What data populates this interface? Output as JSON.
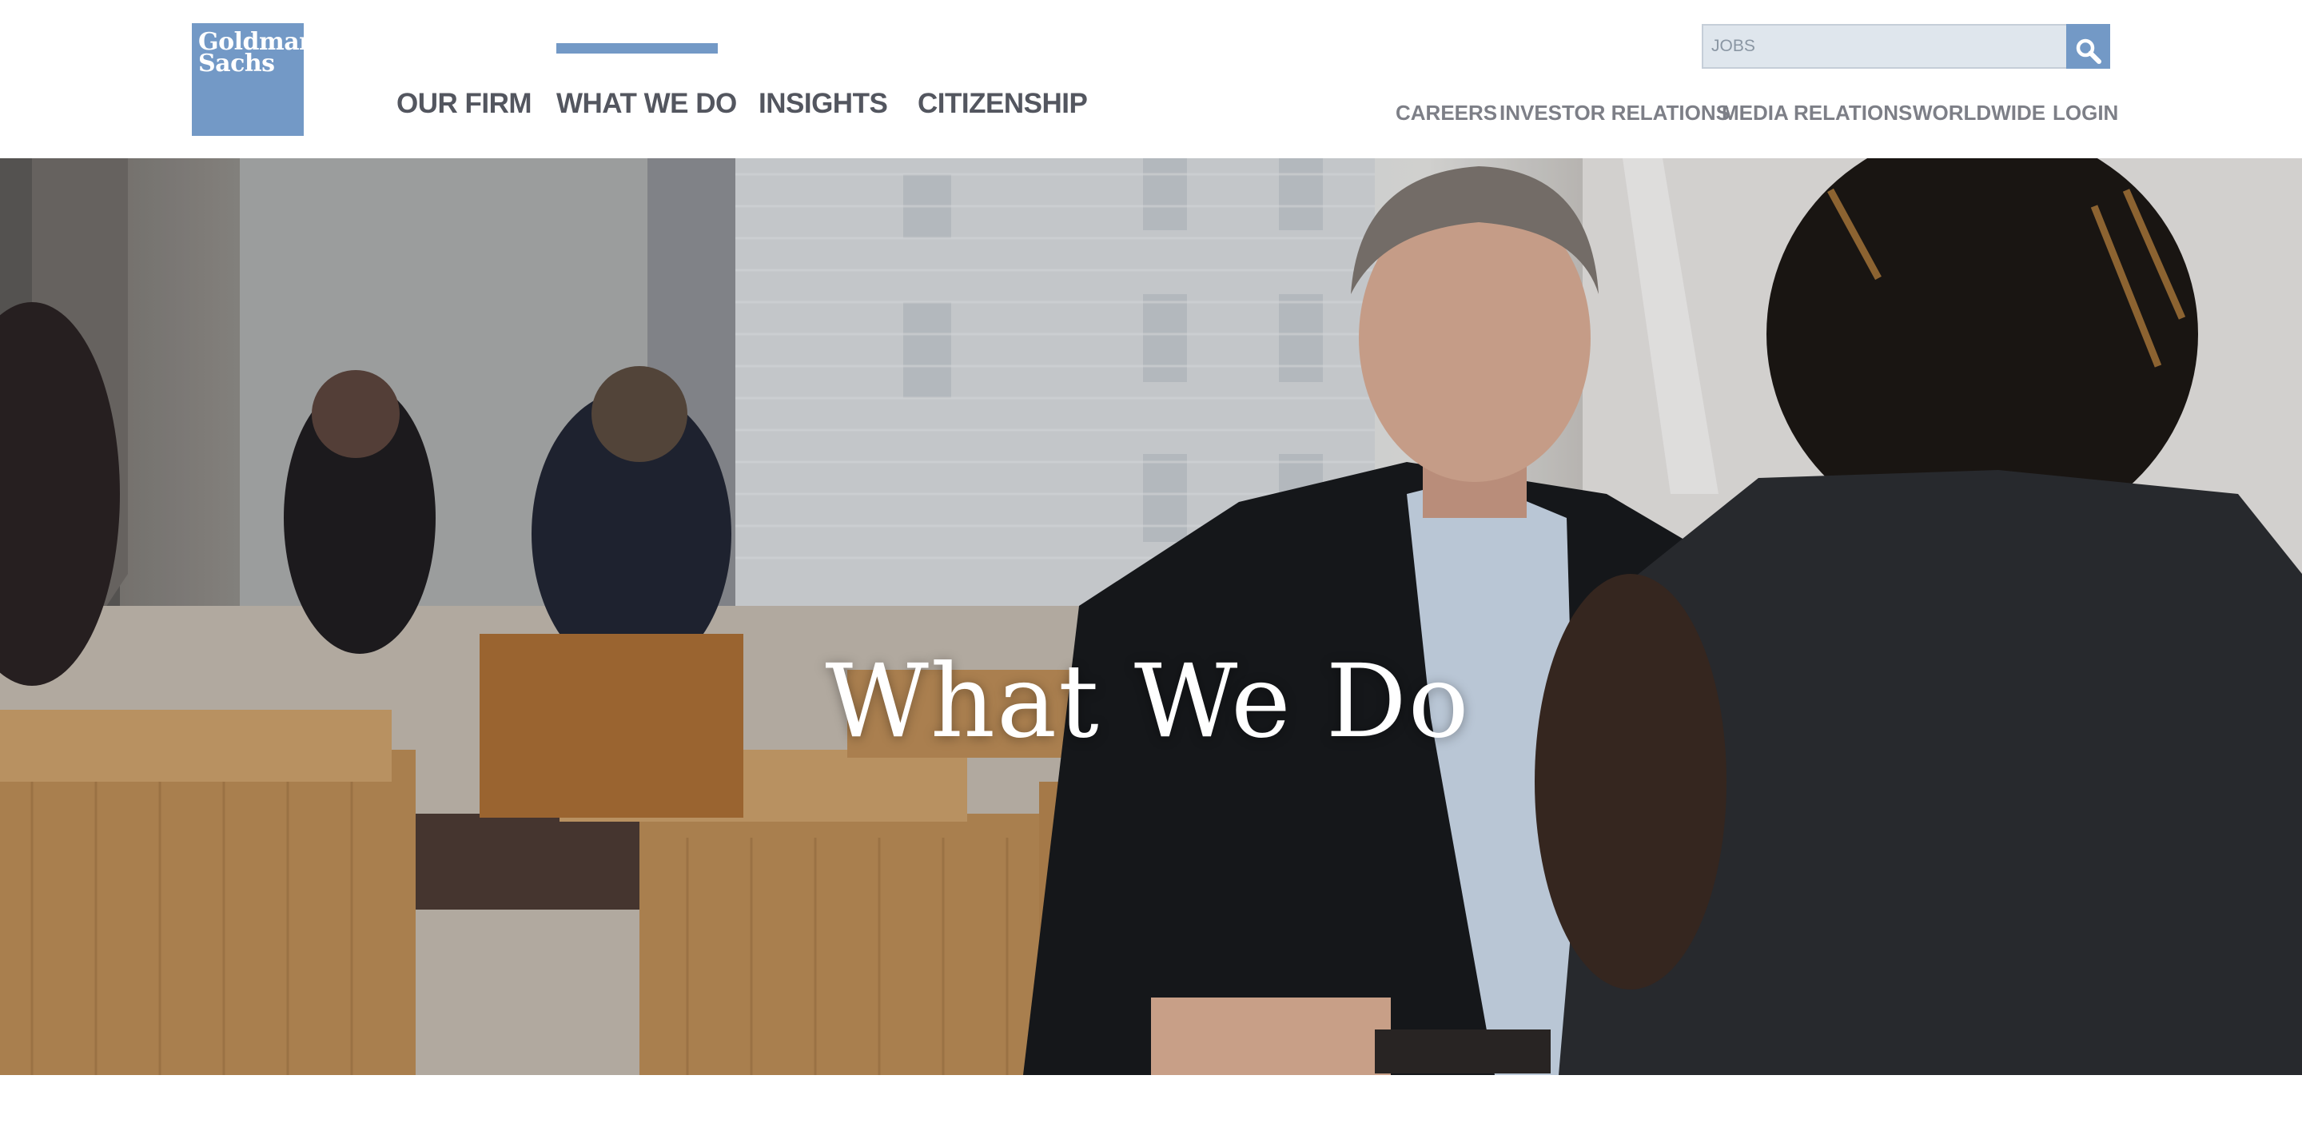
{
  "logo": {
    "line1": "Goldman",
    "line2": "Sachs"
  },
  "main_nav": [
    {
      "label": "OUR FIRM",
      "active": false
    },
    {
      "label": "WHAT WE DO",
      "active": true
    },
    {
      "label": "INSIGHTS",
      "active": false
    },
    {
      "label": "CITIZENSHIP",
      "active": false
    }
  ],
  "search": {
    "placeholder": "JOBS",
    "value": ""
  },
  "utility_nav": [
    {
      "label": "CAREERS"
    },
    {
      "label": "INVESTOR RELATIONS"
    },
    {
      "label": "MEDIA RELATIONS"
    },
    {
      "label": "WORLDWIDE"
    },
    {
      "label": "LOGIN"
    }
  ],
  "hero": {
    "title": "What We Do"
  },
  "colors": {
    "brand_blue": "#7399c6",
    "nav_text": "#53565f",
    "util_text": "#7d7f87",
    "search_bg": "#dfe6ed"
  },
  "icons": {
    "search": "search-icon"
  }
}
